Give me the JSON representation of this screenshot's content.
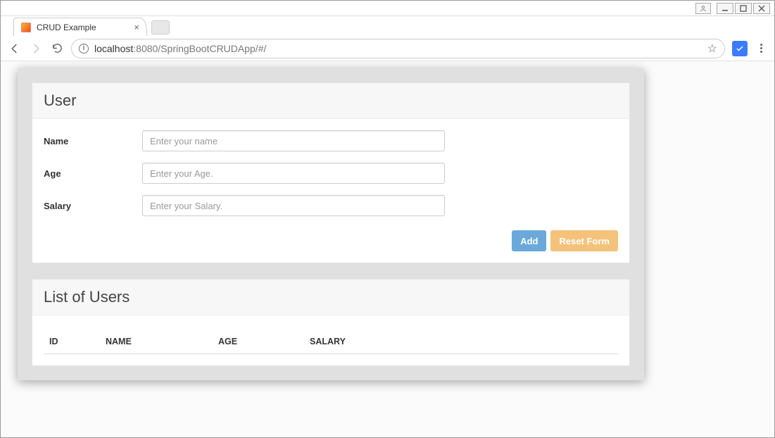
{
  "window": {
    "user_btn": "user",
    "min_btn": "minimize",
    "max_btn": "maximize",
    "close_btn": "close"
  },
  "browser": {
    "tab": {
      "title": "CRUD Example"
    },
    "url_host": "localhost",
    "url_rest": ":8080/SpringBootCRUDApp/#/"
  },
  "form_panel": {
    "heading": "User",
    "fields": {
      "name": {
        "label": "Name",
        "placeholder": "Enter your name",
        "value": ""
      },
      "age": {
        "label": "Age",
        "placeholder": "Enter your Age.",
        "value": ""
      },
      "salary": {
        "label": "Salary",
        "placeholder": "Enter your Salary.",
        "value": ""
      }
    },
    "buttons": {
      "add": "Add",
      "reset": "Reset Form"
    }
  },
  "list_panel": {
    "heading": "List of Users",
    "columns": {
      "id": "ID",
      "name": "NAME",
      "age": "AGE",
      "salary": "SALARY"
    },
    "rows": []
  }
}
